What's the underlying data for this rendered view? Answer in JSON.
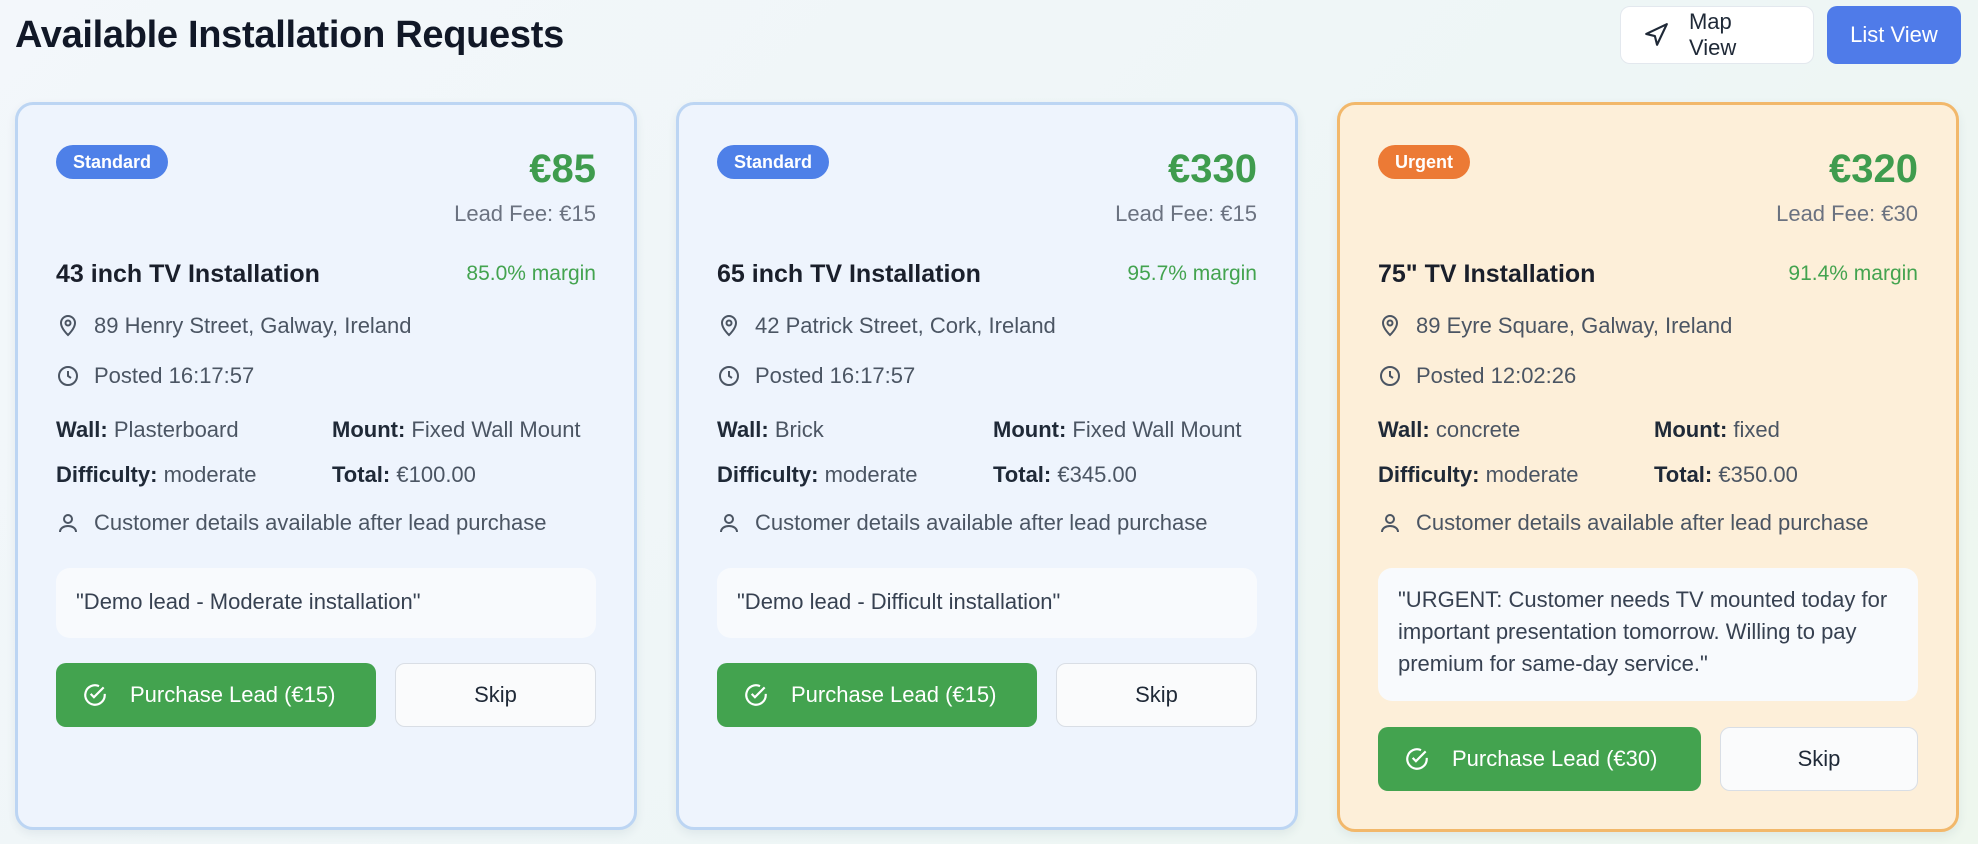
{
  "header": {
    "title": "Available Installation Requests",
    "map_view_label": "Map View",
    "list_view_label": "List View"
  },
  "labels": {
    "wall": "Wall:",
    "mount": "Mount:",
    "difficulty": "Difficulty:",
    "total": "Total:",
    "skip": "Skip"
  },
  "colors": {
    "standard_badge": "#4e80e8",
    "urgent_badge": "#ec7a35",
    "price_green": "#3f9c4e",
    "purchase_button": "#43a34f",
    "list_view_button": "#4f7be9",
    "urgent_card_bg": "#fdefd9",
    "standard_card_bg": "#eef4fd"
  },
  "cards": [
    {
      "badge": "Standard",
      "price": "€85",
      "lead_fee": "Lead Fee: €15",
      "title": "43 inch TV Installation",
      "margin": "85.0% margin",
      "address": "89 Henry Street, Galway, Ireland",
      "posted": "Posted 16:17:57",
      "wall": "Plasterboard",
      "mount": "Fixed Wall Mount",
      "difficulty": "moderate",
      "total": "€100.00",
      "customer_note": "Customer details available after lead purchase",
      "notes": "\"Demo lead - Moderate installation\"",
      "purchase_label": "Purchase Lead (€15)"
    },
    {
      "badge": "Standard",
      "price": "€330",
      "lead_fee": "Lead Fee: €15",
      "title": "65 inch TV Installation",
      "margin": "95.7% margin",
      "address": "42 Patrick Street, Cork, Ireland",
      "posted": "Posted 16:17:57",
      "wall": "Brick",
      "mount": "Fixed Wall Mount",
      "difficulty": "moderate",
      "total": "€345.00",
      "customer_note": "Customer details available after lead purchase",
      "notes": "\"Demo lead - Difficult installation\"",
      "purchase_label": "Purchase Lead (€15)"
    },
    {
      "badge": "Urgent",
      "price": "€320",
      "lead_fee": "Lead Fee: €30",
      "title": "75\" TV Installation",
      "margin": "91.4% margin",
      "address": "89 Eyre Square, Galway, Ireland",
      "posted": "Posted 12:02:26",
      "wall": "concrete",
      "mount": "fixed",
      "difficulty": "moderate",
      "total": "€350.00",
      "customer_note": "Customer details available after lead purchase",
      "notes": "\"URGENT: Customer needs TV mounted today for important presentation tomorrow. Willing to pay premium for same-day service.\"",
      "purchase_label": "Purchase Lead (€30)"
    }
  ]
}
